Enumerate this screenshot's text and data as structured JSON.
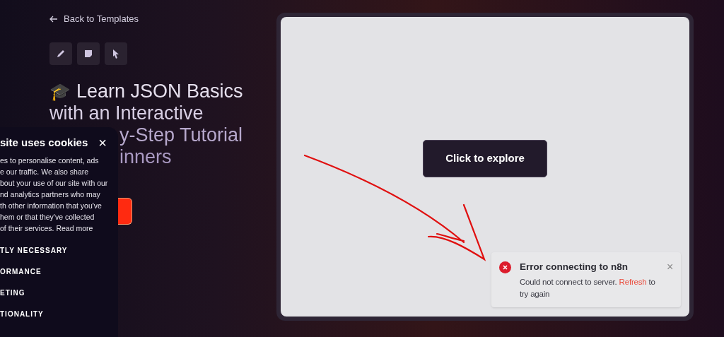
{
  "back_link": "Back to Templates",
  "title": {
    "emoji": "🎓",
    "lines": [
      "Learn JSON Basics",
      "with an Interactive",
      "y-Step Tutorial",
      "inners"
    ]
  },
  "cookie_panel": {
    "close": "×",
    "heading": "site uses cookies",
    "body_lines": [
      "es to personalise content, ads",
      "e our traffic. We also share",
      "bout your use of our site with our",
      "nd analytics partners who may",
      "th other information that you've",
      "hem or that they've collected",
      "of their services."
    ],
    "read_more": "Read more",
    "categories": [
      "TLY NECESSARY",
      "ORMANCE",
      "ETING",
      "TIONALITY"
    ]
  },
  "preview": {
    "button": "Click to explore"
  },
  "toast": {
    "title": "Error connecting to n8n",
    "message": "Could not connect to server.",
    "link": "Refresh",
    "message_end": "to try again",
    "close": "×"
  }
}
